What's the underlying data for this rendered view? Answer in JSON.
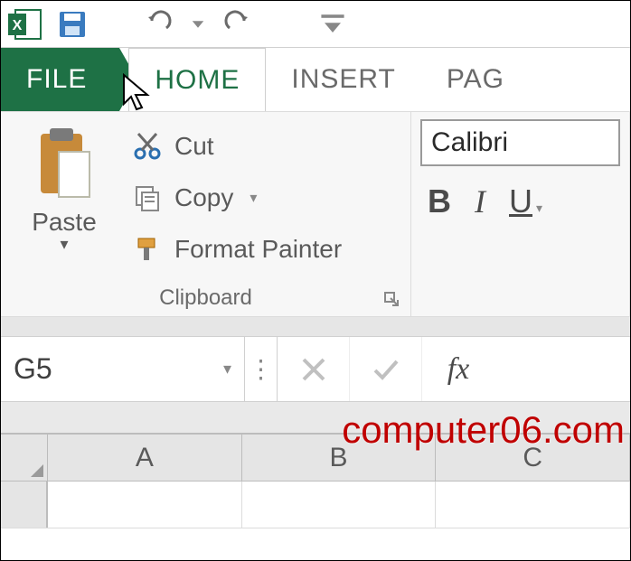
{
  "quick_access": {
    "save_tip": "Save",
    "undo_tip": "Undo",
    "redo_tip": "Redo"
  },
  "tabs": {
    "file": "FILE",
    "home": "HOME",
    "insert": "INSERT",
    "page": "PAG"
  },
  "clipboard": {
    "group_label": "Clipboard",
    "paste": "Paste",
    "cut": "Cut",
    "copy": "Copy",
    "format_painter": "Format Painter"
  },
  "font": {
    "name": "Calibri",
    "bold": "B",
    "italic": "I",
    "underline": "U"
  },
  "namebox": {
    "value": "G5"
  },
  "formula_bar": {
    "fx_label": "fx"
  },
  "columns": [
    "A",
    "B",
    "C"
  ],
  "watermark": "computer06.com",
  "colors": {
    "excel_green": "#1e7145",
    "accent_red": "#c00000"
  }
}
